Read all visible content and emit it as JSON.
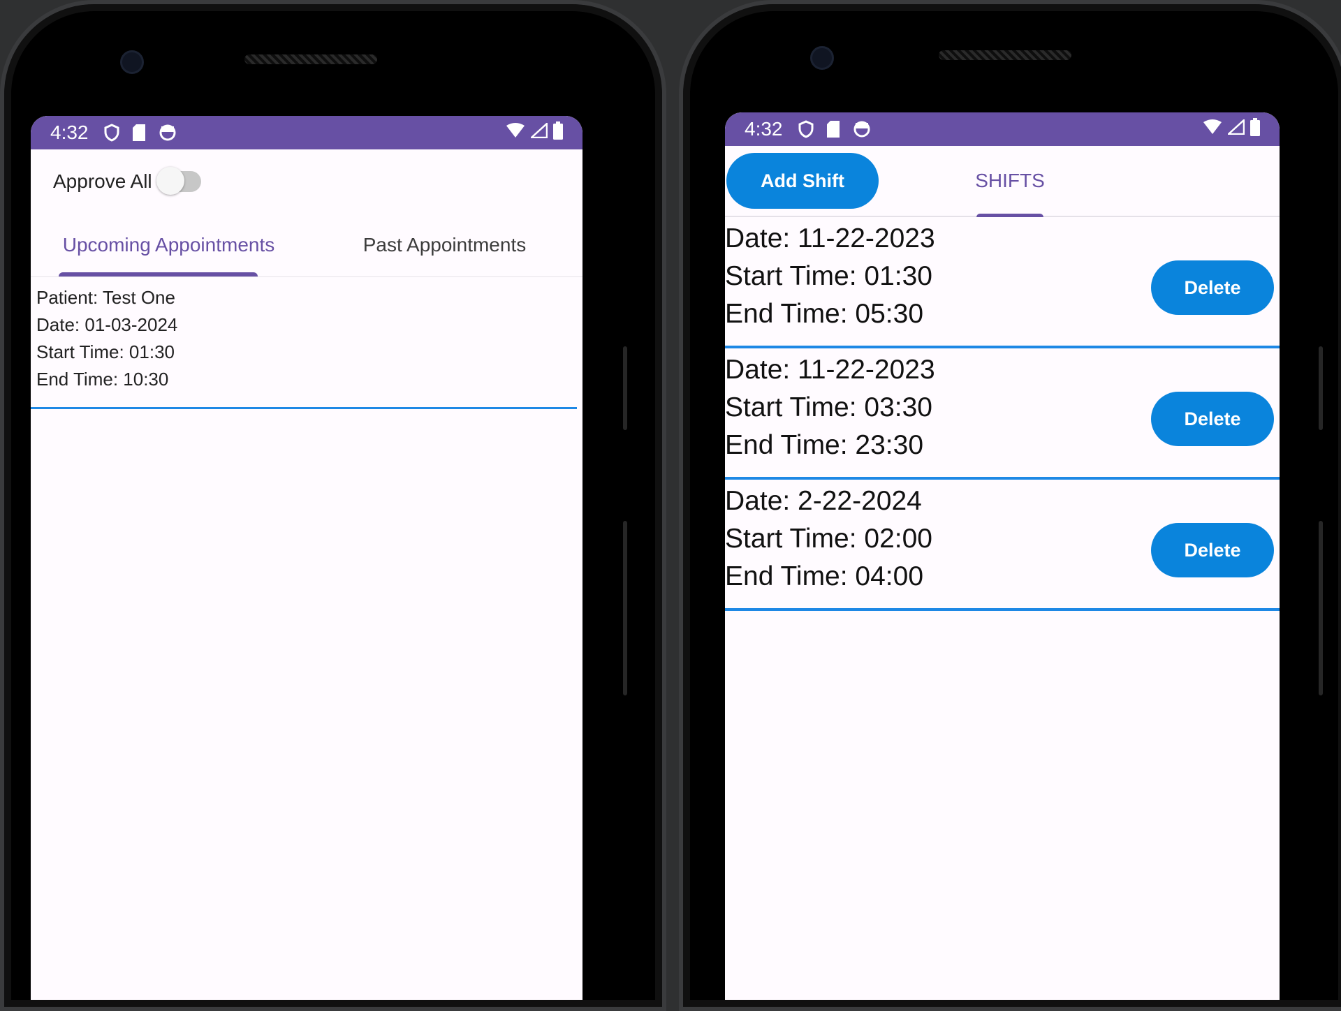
{
  "status_bar": {
    "time": "4:32",
    "left_icons": [
      "shield-icon",
      "sd-card-icon",
      "sync-icon"
    ],
    "right_icons": [
      "wifi-icon",
      "signal-icon",
      "battery-icon"
    ],
    "accent_color": "#6750a4"
  },
  "left_screen": {
    "approve_all_label": "Approve All",
    "approve_all_on": false,
    "tabs": [
      {
        "label": "Upcoming Appointments",
        "active": true
      },
      {
        "label": "Past Appointments",
        "active": false
      }
    ],
    "appointments": [
      {
        "patient": "Patient: Test One",
        "date": "Date: 01-03-2024",
        "start": "Start Time: 01:30",
        "end": "End Time: 10:30"
      }
    ]
  },
  "right_screen": {
    "add_shift_label": "Add Shift",
    "tab_label": "SHIFTS",
    "button_color": "#0a84dc",
    "divider_color": "#1e88e5",
    "shifts": [
      {
        "date": "Date: 11-22-2023",
        "start": "Start Time: 01:30",
        "end": "End Time: 05:30",
        "delete_label": "Delete"
      },
      {
        "date": "Date: 11-22-2023",
        "start": "Start Time: 03:30",
        "end": "End Time: 23:30",
        "delete_label": "Delete"
      },
      {
        "date": "Date: 2-22-2024",
        "start": "Start Time: 02:00",
        "end": "End Time: 04:00",
        "delete_label": "Delete"
      }
    ]
  }
}
